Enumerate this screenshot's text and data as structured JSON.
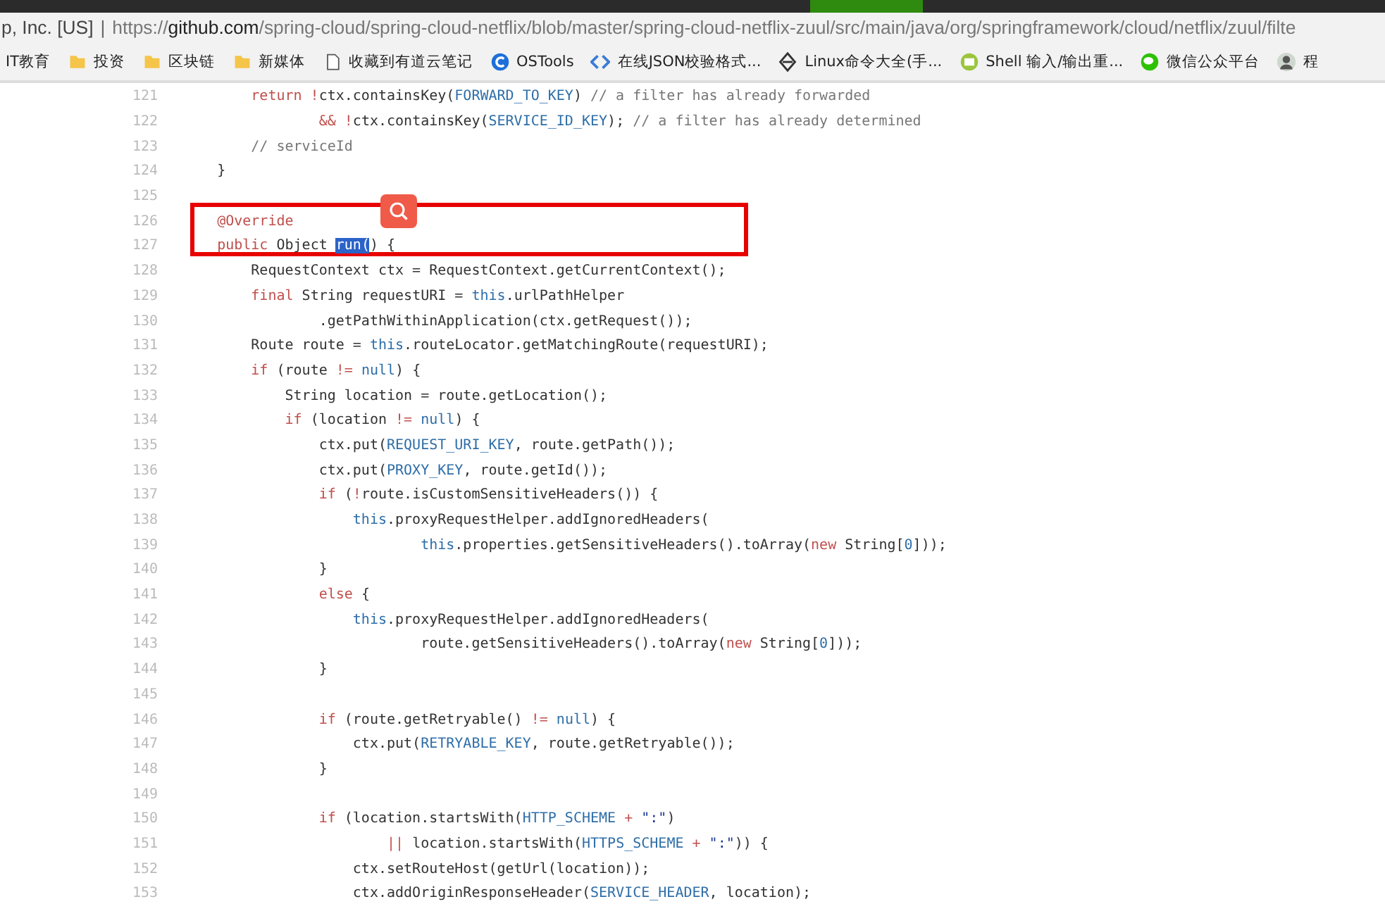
{
  "address_bar": {
    "site_identity": "p, Inc. [US]",
    "separator": "|",
    "url_scheme": "https://",
    "url_host": "github.com",
    "url_path": "/spring-cloud/spring-cloud-netflix/blob/master/spring-cloud-netflix-zuul/src/main/java/org/springframework/cloud/netflix/zuul/filte"
  },
  "bookmarks": [
    {
      "kind": "none",
      "label": "IT教育"
    },
    {
      "kind": "folder",
      "label": "投资"
    },
    {
      "kind": "folder",
      "label": "区块链"
    },
    {
      "kind": "folder",
      "label": "新媒体"
    },
    {
      "kind": "page",
      "label": "收藏到有道云笔记"
    },
    {
      "kind": "letter-logo",
      "label": "OSTools"
    },
    {
      "kind": "code",
      "label": "在线JSON校验格式..."
    },
    {
      "kind": "diamond",
      "label": "Linux命令大全(手..."
    },
    {
      "kind": "terminal",
      "label": "Shell 输入/输出重..."
    },
    {
      "kind": "chat",
      "label": "微信公众平台"
    },
    {
      "kind": "avatar",
      "label": "程"
    }
  ],
  "code": {
    "lines": [
      {
        "number": "121",
        "highlighted": false,
        "segments": [
          {
            "kind": "keyword",
            "text": "        return !"
          },
          {
            "kind": "plain",
            "text": "ctx.containsKey("
          },
          {
            "kind": "constant",
            "text": "FORWARD_TO_KEY"
          },
          {
            "kind": "plain",
            "text": ") "
          },
          {
            "kind": "comment",
            "text": "// a filter has already forwarded"
          }
        ]
      },
      {
        "number": "122",
        "highlighted": false,
        "segments": [
          {
            "kind": "keyword",
            "text": "                && !"
          },
          {
            "kind": "plain",
            "text": "ctx.containsKey("
          },
          {
            "kind": "constant",
            "text": "SERVICE_ID_KEY"
          },
          {
            "kind": "plain",
            "text": "); "
          },
          {
            "kind": "comment",
            "text": "// a filter has already determined"
          }
        ]
      },
      {
        "number": "123",
        "highlighted": false,
        "segments": [
          {
            "kind": "comment",
            "text": "        // serviceId"
          }
        ]
      },
      {
        "number": "124",
        "highlighted": false,
        "segments": [
          {
            "kind": "plain",
            "text": "    }"
          }
        ]
      },
      {
        "number": "125",
        "highlighted": false
      },
      {
        "number": "126",
        "highlighted": true,
        "segments": [
          {
            "kind": "keyword",
            "text": "    @Override"
          }
        ]
      },
      {
        "number": "127",
        "highlighted": true,
        "segments": [
          {
            "kind": "keyword",
            "text": "    public"
          },
          {
            "kind": "plain",
            "text": " Object "
          },
          {
            "kind": "selection",
            "text": "run("
          },
          {
            "kind": "plain",
            "text": ") {"
          }
        ]
      },
      {
        "number": "128",
        "highlighted": false,
        "segments": [
          {
            "kind": "plain",
            "text": "        RequestContext ctx = RequestContext.getCurrentContext();"
          }
        ]
      },
      {
        "number": "129",
        "highlighted": false,
        "segments": [
          {
            "kind": "keyword",
            "text": "        final"
          },
          {
            "kind": "plain",
            "text": " String requestURI = "
          },
          {
            "kind": "constant",
            "text": "this"
          },
          {
            "kind": "plain",
            "text": ".urlPathHelper"
          }
        ]
      },
      {
        "number": "130",
        "highlighted": false,
        "segments": [
          {
            "kind": "plain",
            "text": "                .getPathWithinApplication(ctx.getRequest());"
          }
        ]
      },
      {
        "number": "131",
        "highlighted": false,
        "segments": [
          {
            "kind": "plain",
            "text": "        Route route = "
          },
          {
            "kind": "constant",
            "text": "this"
          },
          {
            "kind": "plain",
            "text": ".routeLocator.getMatchingRoute(requestURI);"
          }
        ]
      },
      {
        "number": "132",
        "highlighted": false,
        "segments": [
          {
            "kind": "keyword",
            "text": "        if"
          },
          {
            "kind": "plain",
            "text": " (route "
          },
          {
            "kind": "keyword",
            "text": "!="
          },
          {
            "kind": "constant",
            "text": " null"
          },
          {
            "kind": "plain",
            "text": ") {"
          }
        ]
      },
      {
        "number": "133",
        "highlighted": false,
        "segments": [
          {
            "kind": "plain",
            "text": "            String location = route.getLocation();"
          }
        ]
      },
      {
        "number": "134",
        "highlighted": false,
        "segments": [
          {
            "kind": "keyword",
            "text": "            if"
          },
          {
            "kind": "plain",
            "text": " (location "
          },
          {
            "kind": "keyword",
            "text": "!="
          },
          {
            "kind": "constant",
            "text": " null"
          },
          {
            "kind": "plain",
            "text": ") {"
          }
        ]
      },
      {
        "number": "135",
        "highlighted": false,
        "segments": [
          {
            "kind": "plain",
            "text": "                ctx.put("
          },
          {
            "kind": "constant",
            "text": "REQUEST_URI_KEY"
          },
          {
            "kind": "plain",
            "text": ", route.getPath());"
          }
        ]
      },
      {
        "number": "136",
        "highlighted": false,
        "segments": [
          {
            "kind": "plain",
            "text": "                ctx.put("
          },
          {
            "kind": "constant",
            "text": "PROXY_KEY"
          },
          {
            "kind": "plain",
            "text": ", route.getId());"
          }
        ]
      },
      {
        "number": "137",
        "highlighted": false,
        "segments": [
          {
            "kind": "keyword",
            "text": "                if"
          },
          {
            "kind": "plain",
            "text": " ("
          },
          {
            "kind": "keyword",
            "text": "!"
          },
          {
            "kind": "plain",
            "text": "route.isCustomSensitiveHeaders()) {"
          }
        ]
      },
      {
        "number": "138",
        "highlighted": false,
        "segments": [
          {
            "kind": "constant",
            "text": "                    this"
          },
          {
            "kind": "plain",
            "text": ".proxyRequestHelper.addIgnoredHeaders("
          }
        ]
      },
      {
        "number": "139",
        "highlighted": false,
        "segments": [
          {
            "kind": "constant",
            "text": "                            this"
          },
          {
            "kind": "plain",
            "text": ".properties.getSensitiveHeaders().toArray("
          },
          {
            "kind": "keyword",
            "text": "new"
          },
          {
            "kind": "plain",
            "text": " String["
          },
          {
            "kind": "constant",
            "text": "0"
          },
          {
            "kind": "plain",
            "text": "]));"
          }
        ]
      },
      {
        "number": "140",
        "highlighted": false,
        "segments": [
          {
            "kind": "plain",
            "text": "                }"
          }
        ]
      },
      {
        "number": "141",
        "highlighted": false,
        "segments": [
          {
            "kind": "keyword",
            "text": "                else"
          },
          {
            "kind": "plain",
            "text": " {"
          }
        ]
      },
      {
        "number": "142",
        "highlighted": false,
        "segments": [
          {
            "kind": "constant",
            "text": "                    this"
          },
          {
            "kind": "plain",
            "text": ".proxyRequestHelper.addIgnoredHeaders("
          }
        ]
      },
      {
        "number": "143",
        "highlighted": false,
        "segments": [
          {
            "kind": "plain",
            "text": "                            route.getSensitiveHeaders().toArray("
          },
          {
            "kind": "keyword",
            "text": "new"
          },
          {
            "kind": "plain",
            "text": " String["
          },
          {
            "kind": "constant",
            "text": "0"
          },
          {
            "kind": "plain",
            "text": "]));"
          }
        ]
      },
      {
        "number": "144",
        "highlighted": false,
        "segments": [
          {
            "kind": "plain",
            "text": "                }"
          }
        ]
      },
      {
        "number": "145",
        "highlighted": false
      },
      {
        "number": "146",
        "highlighted": false,
        "segments": [
          {
            "kind": "keyword",
            "text": "                if"
          },
          {
            "kind": "plain",
            "text": " (route.getRetryable() "
          },
          {
            "kind": "keyword",
            "text": "!="
          },
          {
            "kind": "constant",
            "text": " null"
          },
          {
            "kind": "plain",
            "text": ") {"
          }
        ]
      },
      {
        "number": "147",
        "highlighted": false,
        "segments": [
          {
            "kind": "plain",
            "text": "                    ctx.put("
          },
          {
            "kind": "constant",
            "text": "RETRYABLE_KEY"
          },
          {
            "kind": "plain",
            "text": ", route.getRetryable());"
          }
        ]
      },
      {
        "number": "148",
        "highlighted": false,
        "segments": [
          {
            "kind": "plain",
            "text": "                }"
          }
        ]
      },
      {
        "number": "149",
        "highlighted": false
      },
      {
        "number": "150",
        "highlighted": false,
        "segments": [
          {
            "kind": "keyword",
            "text": "                if"
          },
          {
            "kind": "plain",
            "text": " (location.startsWith("
          },
          {
            "kind": "constant",
            "text": "HTTP_SCHEME"
          },
          {
            "kind": "keyword",
            "text": " + "
          },
          {
            "kind": "string",
            "text": "\":\""
          },
          {
            "kind": "plain",
            "text": ")"
          }
        ]
      },
      {
        "number": "151",
        "highlighted": false,
        "segments": [
          {
            "kind": "keyword",
            "text": "                        ||"
          },
          {
            "kind": "plain",
            "text": " location.startsWith("
          },
          {
            "kind": "constant",
            "text": "HTTPS_SCHEME"
          },
          {
            "kind": "keyword",
            "text": " + "
          },
          {
            "kind": "string",
            "text": "\":\""
          },
          {
            "kind": "plain",
            "text": ")) {"
          }
        ]
      },
      {
        "number": "152",
        "highlighted": false,
        "segments": [
          {
            "kind": "plain",
            "text": "                    ctx.setRouteHost(getUrl(location));"
          }
        ]
      },
      {
        "number": "153",
        "highlighted": false,
        "segments": [
          {
            "kind": "plain",
            "text": "                    ctx.addOriginResponseHeader("
          },
          {
            "kind": "constant",
            "text": "SERVICE_HEADER"
          },
          {
            "kind": "plain",
            "text": ", location);"
          }
        ]
      }
    ]
  }
}
